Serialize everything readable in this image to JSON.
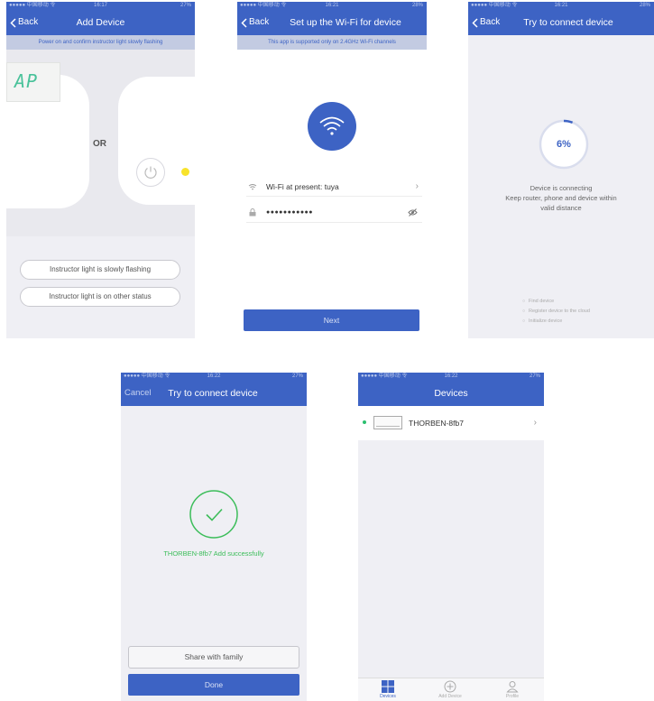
{
  "colors": {
    "primary": "#3d63c4",
    "success": "#3cbd5a",
    "led_yellow": "#f8e32b",
    "online": "#2bbf6f"
  },
  "status": {
    "s1": {
      "carrier": "●●●●● 中国移动 令",
      "time": "16:17",
      "battery": "27%"
    },
    "s2": {
      "carrier": "●●●●● 中国移动 令",
      "time": "16:21",
      "battery": "28%"
    },
    "s3": {
      "carrier": "●●●●● 中国移动 令",
      "time": "16:21",
      "battery": "28%"
    },
    "s4": {
      "carrier": "●●●●● 中国移动 令",
      "time": "16:22",
      "battery": "27%"
    },
    "s5": {
      "carrier": "●●●●● 中国移动 令",
      "time": "16:22",
      "battery": "27%"
    }
  },
  "screen1": {
    "back_label": "Back",
    "title": "Add Device",
    "banner": "Power on and confirm instructor light slowly flashing",
    "lcd_text": "AP",
    "or_text": "OR",
    "option_slow": "Instructor light is slowly flashing",
    "option_other": "Instructor light is on other status"
  },
  "screen2": {
    "back_label": "Back",
    "title": "Set up the Wi-Fi for device",
    "banner": "This app is supported only on 2.4GHz Wi-Fi channels",
    "wifi_label": "Wi-Fi at present: tuya",
    "password_mask": "●●●●●●●●●●●",
    "next_label": "Next"
  },
  "screen3": {
    "back_label": "Back",
    "title": "Try to connect device",
    "progress_percent": 6,
    "progress_label": "6%",
    "status_line1": "Device is connecting",
    "status_line2": "Keep router, phone and device within",
    "status_line3": "valid distance",
    "steps": [
      "Find device",
      "Register device to the cloud",
      "Initialize device"
    ]
  },
  "screen4": {
    "cancel_label": "Cancel",
    "title": "Try to connect device",
    "success_text": "THORBEN-8fb7 Add successfully",
    "share_label": "Share with family",
    "done_label": "Done"
  },
  "screen5": {
    "title": "Devices",
    "device_name": "THORBEN-8fb7",
    "tabs": [
      {
        "label": "Devices",
        "icon": "grid-icon",
        "active": true
      },
      {
        "label": "Add Device",
        "icon": "plus-circle-icon",
        "active": false
      },
      {
        "label": "Profile",
        "icon": "user-icon",
        "active": false
      }
    ]
  }
}
